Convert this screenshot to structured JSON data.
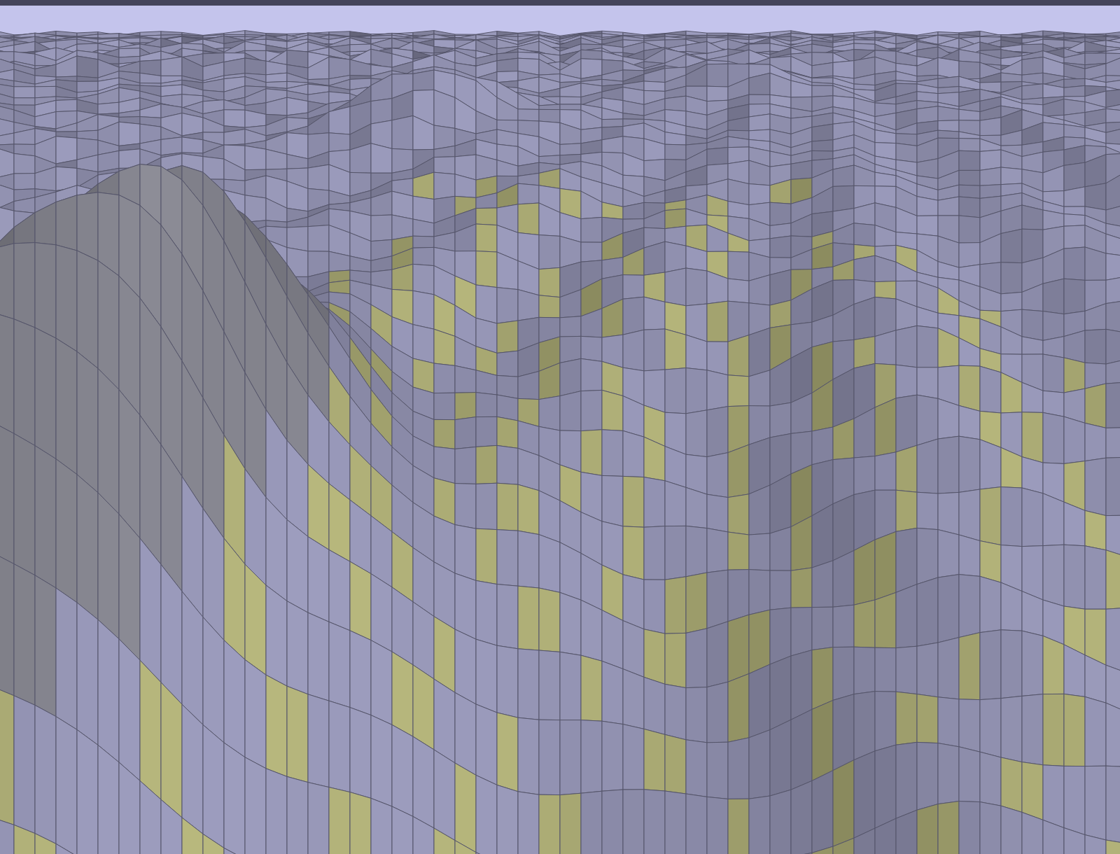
{
  "render": {
    "kind": "wireframe"
  }
}
